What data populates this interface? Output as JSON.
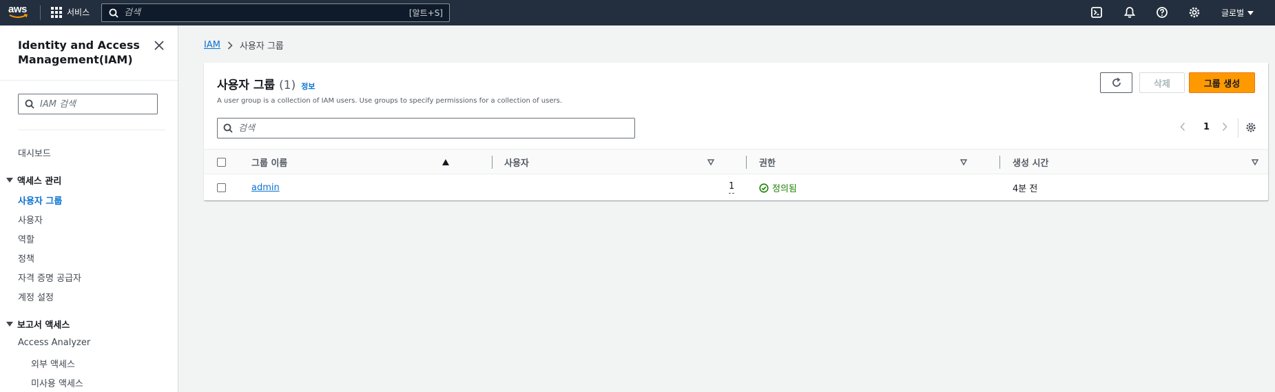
{
  "topnav": {
    "logo_text": "aws",
    "services_label": "서비스",
    "search_placeholder": "검색",
    "search_shortcut": "[알트+S]",
    "region_label": "글로벌",
    "icons": [
      "cloudshell-icon",
      "bell-icon",
      "help-icon",
      "settings-icon"
    ]
  },
  "sidebar": {
    "title": "Identity and Access Management(IAM)",
    "search_placeholder": "IAM 검색",
    "dashboard": "대시보드",
    "sections": [
      {
        "label": "액세스 관리",
        "items": [
          "사용자 그룹",
          "사용자",
          "역할",
          "정책",
          "자격 증명 공급자",
          "계정 설정"
        ],
        "active": "사용자 그룹"
      },
      {
        "label": "보고서 액세스",
        "items": [
          "Access Analyzer"
        ],
        "subitems": [
          "외부 액세스",
          "미사용 액세스"
        ]
      }
    ]
  },
  "breadcrumb": {
    "root": "IAM",
    "current": "사용자 그룹"
  },
  "panel": {
    "title": "사용자 그룹",
    "count": "(1)",
    "info": "정보",
    "description": "A user group is a collection of IAM users. Use groups to specify permissions for a collection of users.",
    "delete_label": "삭제",
    "create_label": "그룹 생성",
    "search_placeholder": "검색",
    "page": "1"
  },
  "table": {
    "columns": [
      "그룹 이름",
      "사용자",
      "권한",
      "생성 시간"
    ],
    "rows": [
      {
        "name": "admin",
        "users": "1",
        "permissions": "정의됨",
        "created": "4분 전"
      }
    ]
  },
  "colors": {
    "nav_bg": "#232f3e",
    "link": "#0972d3",
    "primary_button": "#ff9900",
    "success": "#1d8102"
  }
}
